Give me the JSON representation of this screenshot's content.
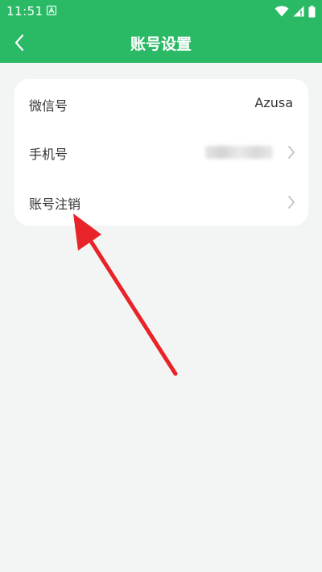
{
  "status_bar": {
    "time": "11:51",
    "icons": [
      "notification-a-icon",
      "wifi-icon",
      "signal-icon",
      "battery-icon"
    ]
  },
  "app_bar": {
    "title": "账号设置",
    "back_icon": "chevron-left-icon",
    "background_color": "#2aba66"
  },
  "settings": {
    "rows": [
      {
        "label": "微信号",
        "value": "Azusa",
        "chevron": false
      },
      {
        "label": "手机号",
        "value_obscured": true,
        "chevron": true
      },
      {
        "label": "账号注销",
        "chevron": true
      }
    ]
  },
  "annotation": {
    "type": "arrow",
    "color": "#e8232a",
    "points_to": "账号注销"
  },
  "colors": {
    "page_background": "#f2f5f3",
    "card_background": "#ffffff",
    "text": "#333333",
    "chevron": "#c4c4c4"
  }
}
